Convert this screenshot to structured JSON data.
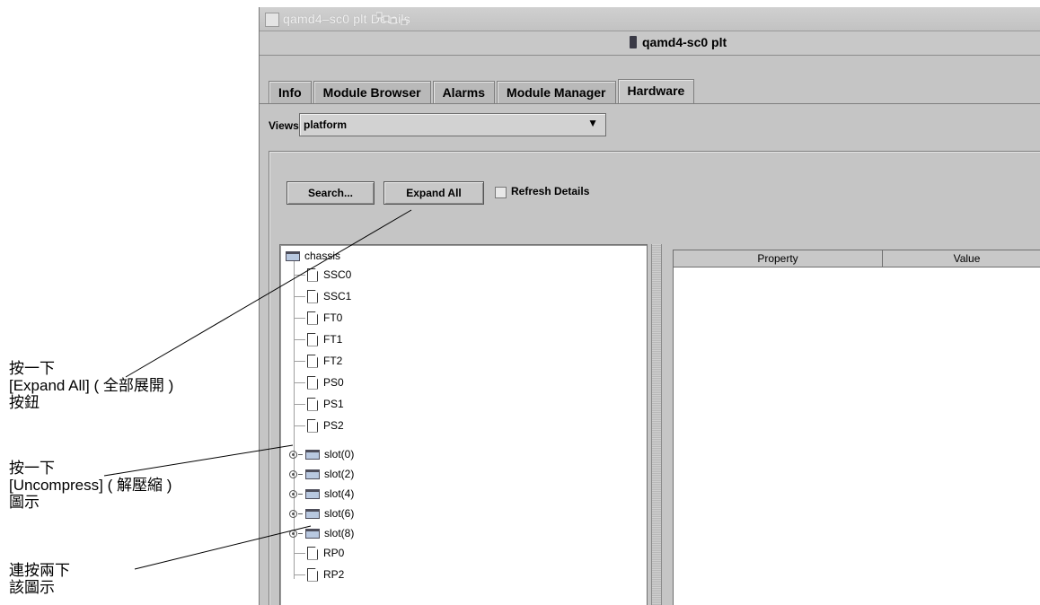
{
  "window": {
    "title": "qamd4–sc0 plt Details",
    "host_label": "qamd4-sc0 plt"
  },
  "tabs": [
    "Info",
    "Module Browser",
    "Alarms",
    "Module Manager",
    "Hardware"
  ],
  "active_tab": "Hardware",
  "views": {
    "label": "Views",
    "value": "platform"
  },
  "toolbar": {
    "search_label": "Search...",
    "expand_all_label": "Expand All",
    "refresh_label": "Refresh Details"
  },
  "tree": {
    "root": "chassis",
    "children": [
      "SSC0",
      "SSC1",
      "FT0",
      "FT1",
      "FT2",
      "PS0",
      "PS1",
      "PS2"
    ],
    "slots": [
      "slot(0)",
      "slot(2)",
      "slot(4)",
      "slot(6)",
      "slot(8)"
    ],
    "tail": [
      "RP0",
      "RP2"
    ]
  },
  "property_table": {
    "headers": [
      "Property",
      "Value"
    ]
  },
  "callouts": {
    "expand_all": [
      "按一下",
      "[Expand All] ( 全部展開 )",
      "按鈕"
    ],
    "uncompress": [
      "按一下",
      "[Uncompress] ( 解壓縮 )",
      "圖示"
    ],
    "double_click": [
      "連按兩下",
      "該圖示"
    ]
  }
}
